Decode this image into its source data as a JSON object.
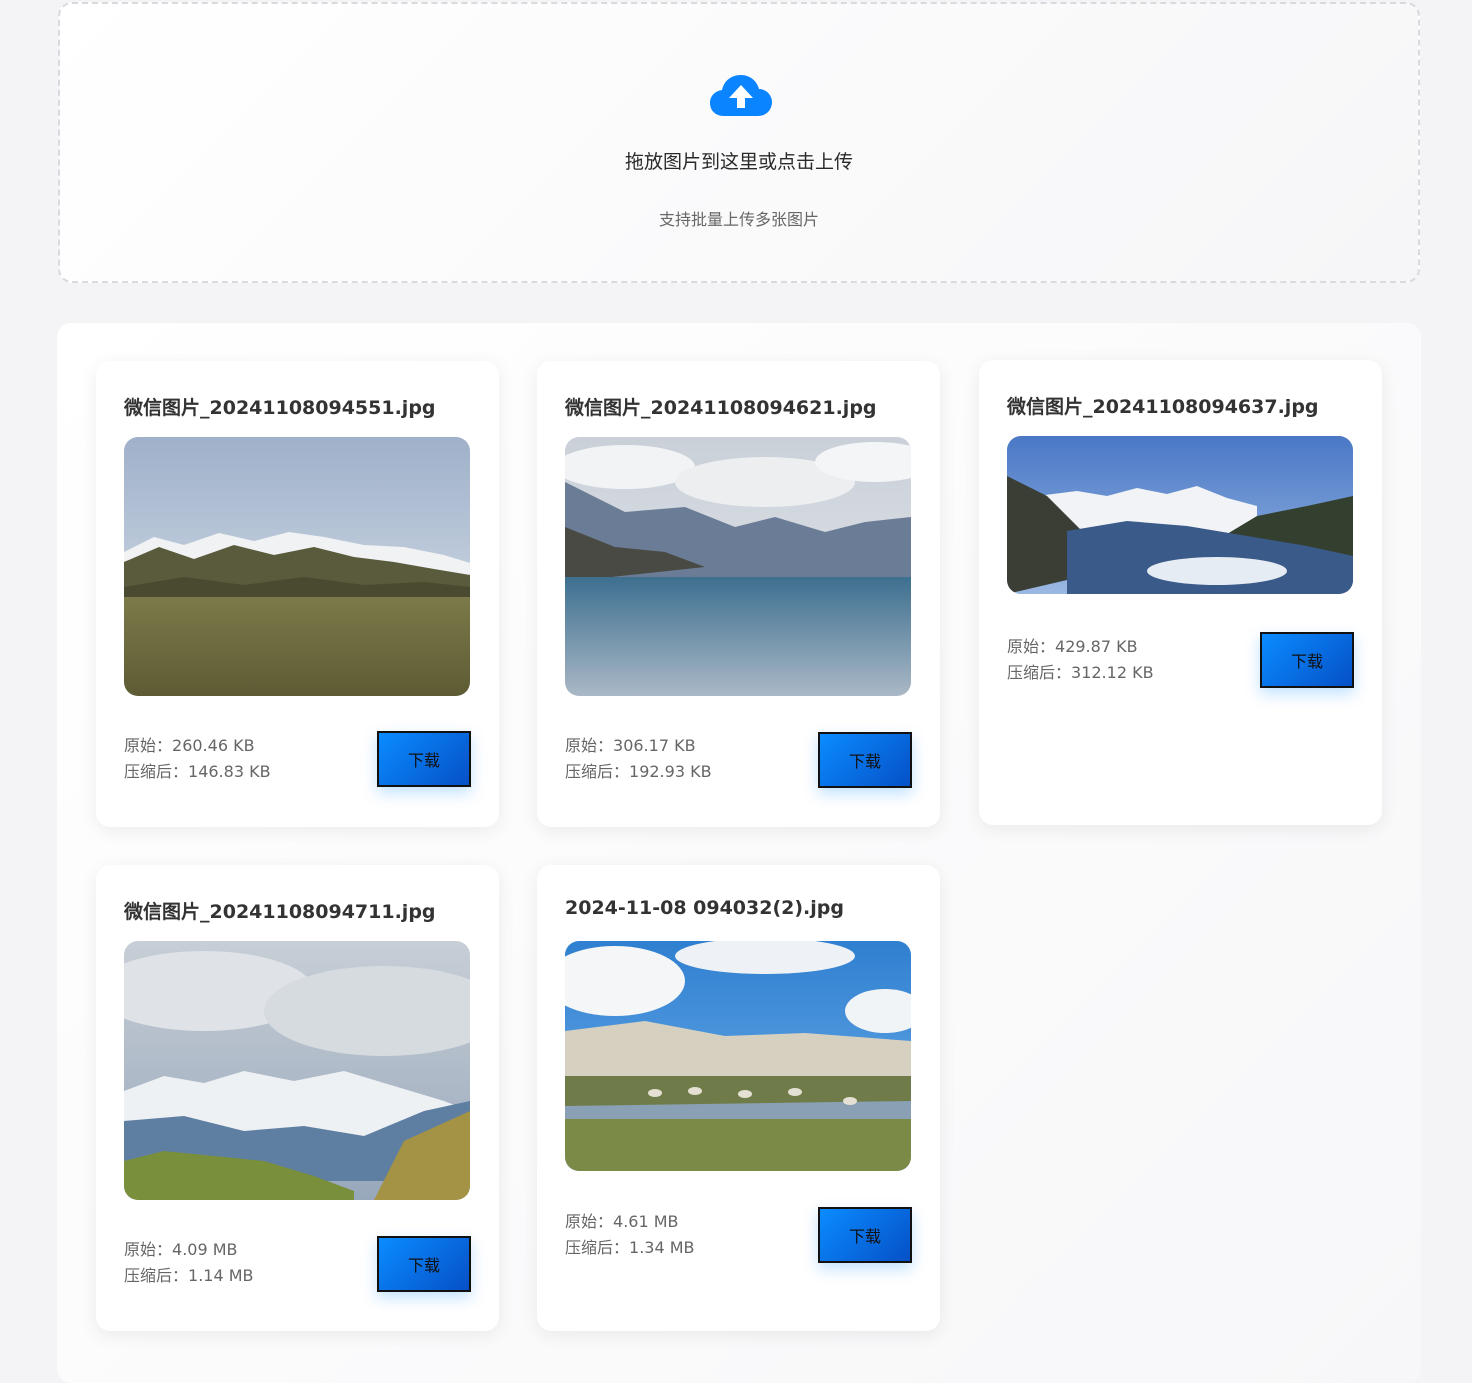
{
  "upload": {
    "title": "拖放图片到这里或点击上传",
    "subtitle": "支持批量上传多张图片"
  },
  "labels": {
    "original": "原始：",
    "compressed": "压缩后：",
    "download": "下载"
  },
  "cards": [
    {
      "filename": "微信图片_20241108094551.jpg",
      "original": "260.46 KB",
      "compressed": "146.83 KB"
    },
    {
      "filename": "微信图片_20241108094621.jpg",
      "original": "306.17 KB",
      "compressed": "192.93 KB"
    },
    {
      "filename": "微信图片_20241108094637.jpg",
      "original": "429.87 KB",
      "compressed": "312.12 KB"
    },
    {
      "filename": "微信图片_20241108094711.jpg",
      "original": "4.09 MB",
      "compressed": "1.14 MB"
    },
    {
      "filename": "2024-11-08 094032(2).jpg",
      "original": "4.61 MB",
      "compressed": "1.34 MB"
    }
  ],
  "colors": {
    "accent": "#0a8cff",
    "accent_dark": "#0650c7"
  }
}
